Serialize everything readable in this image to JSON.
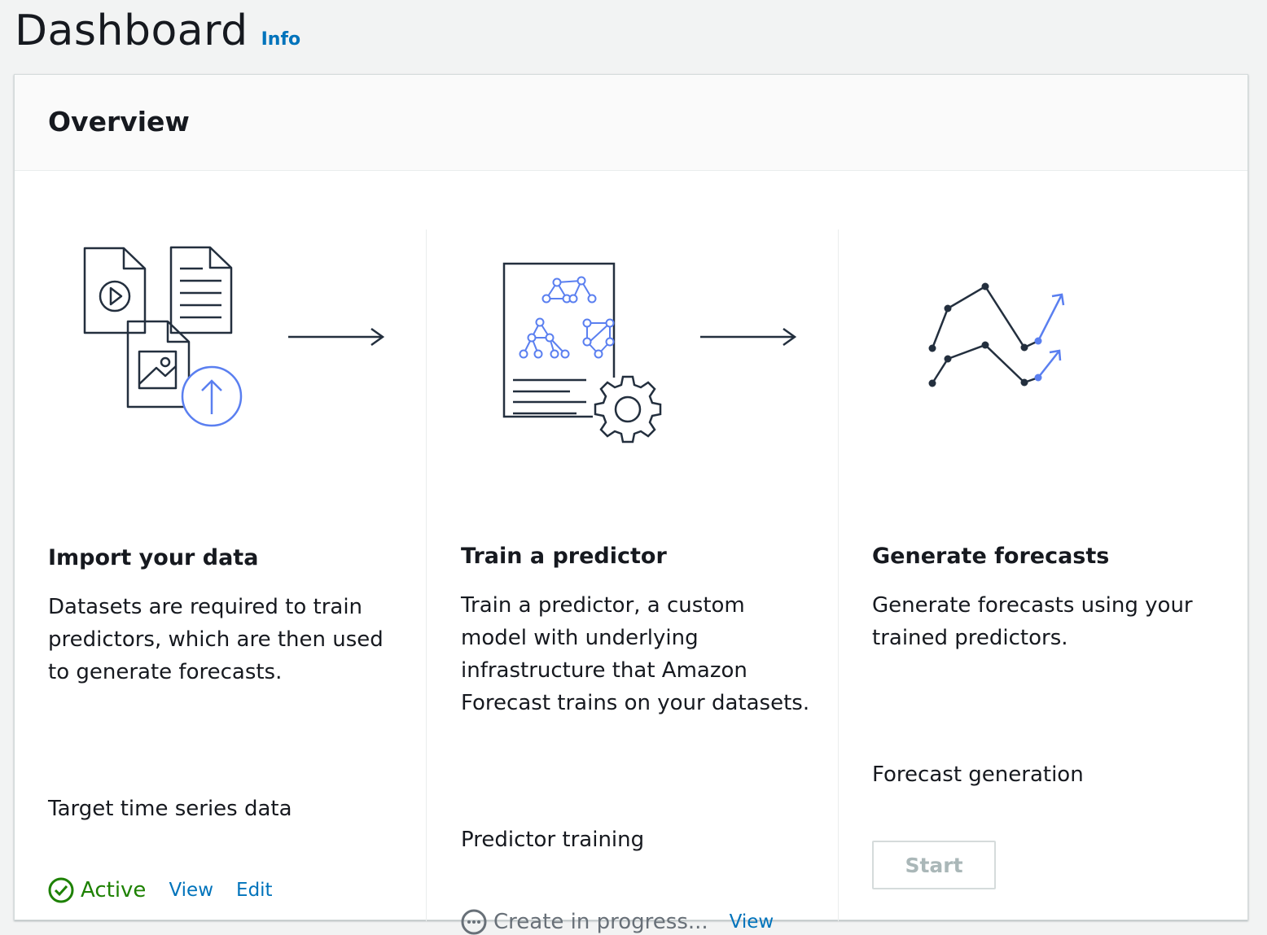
{
  "header": {
    "title": "Dashboard",
    "info_label": "Info"
  },
  "overview": {
    "title": "Overview",
    "steps": [
      {
        "title": "Import your data",
        "description": "Datasets are required to train predictors, which are then used to generate forecasts.",
        "status_label": "Target time series data",
        "status": "Active",
        "links": [
          "View",
          "Edit"
        ]
      },
      {
        "title": "Train a predictor",
        "description": "Train a predictor, a custom model with underlying infrastructure that Amazon Forecast trains on your datasets.",
        "status_label": "Predictor training",
        "status": "Create in progress...",
        "links": [
          "View"
        ]
      },
      {
        "title": "Generate forecasts",
        "description": "Generate forecasts using your trained predictors.",
        "status_label": "Forecast generation",
        "button": "Start"
      }
    ]
  },
  "colors": {
    "link": "#0073bb",
    "success": "#1d8102",
    "accent_illustration": "#5a7ff0",
    "muted": "#687078"
  }
}
